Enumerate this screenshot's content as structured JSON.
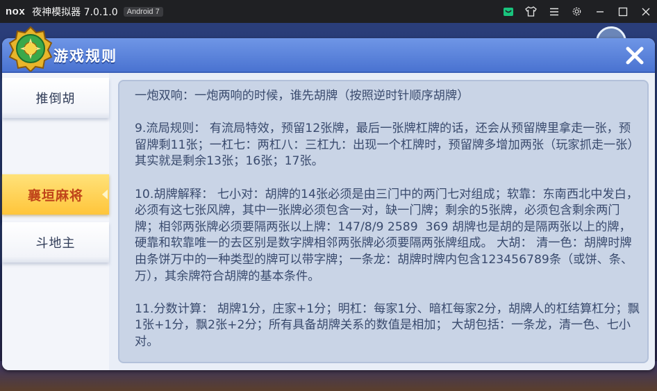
{
  "emulator": {
    "logo": "nox",
    "title": "夜神模拟器 7.0.1.0",
    "android_badge": "Android 7",
    "icons": [
      "store-icon",
      "shirt-icon",
      "menu-icon",
      "settings-icon",
      "minimize-icon",
      "maximize-icon",
      "close-icon"
    ]
  },
  "dialog": {
    "title": "游戏规则",
    "close_glyph": "✕"
  },
  "sidebar": {
    "items": [
      {
        "label": "推倒胡",
        "active": false
      },
      {
        "label": "襄垣麻将",
        "active": true
      },
      {
        "label": "斗地主",
        "active": false
      }
    ]
  },
  "rules": {
    "paragraphs": [
      "一炮双响：一炮两响的时候，谁先胡牌（按照逆时针顺序胡牌）",
      "9.流局规则： 有流局特效，预留12张牌，最后一张牌杠牌的话，还会从预留牌里拿走一张，预留牌剩11张；一杠七：两杠八：三杠九：出现一个杠牌时，预留牌多增加两张（玩家抓走一张）其实就是剩余13张；16张；17张。",
      "10.胡牌解释： 七小对：胡牌的14张必须是由三门中的两门七对组成；软靠：东南西北中发白，必须有这七张风牌，其中一张牌必须包含一对，缺一门牌；剩余的5张牌，必须包含剩余两门牌；相邻两张牌必须要隔两张以上牌：147/8/9 2589  369 胡牌也是胡的是隔两张以上的牌，硬靠和软靠唯一的去区别是数字牌相邻两张牌必须要隔两张牌组成。 大胡： 清一色：胡牌时牌由条饼万中的一种类型的牌可以带字牌；一条龙：胡牌时牌内包含123456789条（或饼、条、万），其余牌符合胡牌的基本条件。",
      "11.分数计算： 胡牌1分，庄家+1分；明杠：每家1分、暗杠每家2分，胡牌人的杠结算杠分；飘1张+1分，飘2张+2分；所有具备胡牌关系的数值是相加； 大胡包括：一条龙，清一色、七小对。"
    ]
  },
  "colors": {
    "header_blue": "#4a73d1",
    "active_tab": "#ffc53a",
    "active_text": "#c0451a",
    "rule_text": "#394a6d",
    "panel_bg": "#c9d4e6"
  }
}
